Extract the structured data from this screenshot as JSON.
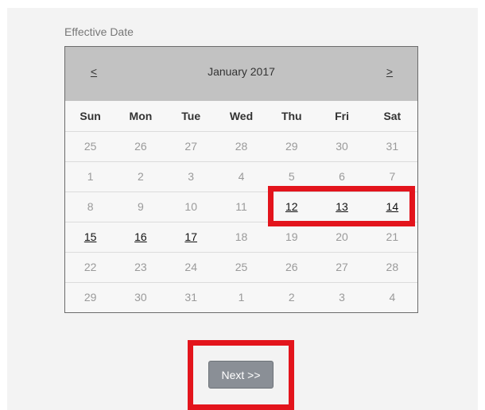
{
  "field_label": "Effective Date",
  "calendar": {
    "prev_label": "<",
    "next_label": ">",
    "month_title": "January 2017",
    "weekdays": [
      "Sun",
      "Mon",
      "Tue",
      "Wed",
      "Thu",
      "Fri",
      "Sat"
    ],
    "weeks": [
      [
        {
          "d": "25",
          "a": false
        },
        {
          "d": "26",
          "a": false
        },
        {
          "d": "27",
          "a": false
        },
        {
          "d": "28",
          "a": false
        },
        {
          "d": "29",
          "a": false
        },
        {
          "d": "30",
          "a": false
        },
        {
          "d": "31",
          "a": false
        }
      ],
      [
        {
          "d": "1",
          "a": false
        },
        {
          "d": "2",
          "a": false
        },
        {
          "d": "3",
          "a": false
        },
        {
          "d": "4",
          "a": false
        },
        {
          "d": "5",
          "a": false
        },
        {
          "d": "6",
          "a": false
        },
        {
          "d": "7",
          "a": false
        }
      ],
      [
        {
          "d": "8",
          "a": false
        },
        {
          "d": "9",
          "a": false
        },
        {
          "d": "10",
          "a": false
        },
        {
          "d": "11",
          "a": false
        },
        {
          "d": "12",
          "a": true
        },
        {
          "d": "13",
          "a": true
        },
        {
          "d": "14",
          "a": true
        }
      ],
      [
        {
          "d": "15",
          "a": true
        },
        {
          "d": "16",
          "a": true
        },
        {
          "d": "17",
          "a": true
        },
        {
          "d": "18",
          "a": false
        },
        {
          "d": "19",
          "a": false
        },
        {
          "d": "20",
          "a": false
        },
        {
          "d": "21",
          "a": false
        }
      ],
      [
        {
          "d": "22",
          "a": false
        },
        {
          "d": "23",
          "a": false
        },
        {
          "d": "24",
          "a": false
        },
        {
          "d": "25",
          "a": false
        },
        {
          "d": "26",
          "a": false
        },
        {
          "d": "27",
          "a": false
        },
        {
          "d": "28",
          "a": false
        }
      ],
      [
        {
          "d": "29",
          "a": false
        },
        {
          "d": "30",
          "a": false
        },
        {
          "d": "31",
          "a": false
        },
        {
          "d": "1",
          "a": false
        },
        {
          "d": "2",
          "a": false
        },
        {
          "d": "3",
          "a": false
        },
        {
          "d": "4",
          "a": false
        }
      ]
    ]
  },
  "next_button_label": "Next >>",
  "colors": {
    "header_bg": "#c2c2c2",
    "highlight": "#e3141c",
    "button_bg": "#8a8f96"
  }
}
